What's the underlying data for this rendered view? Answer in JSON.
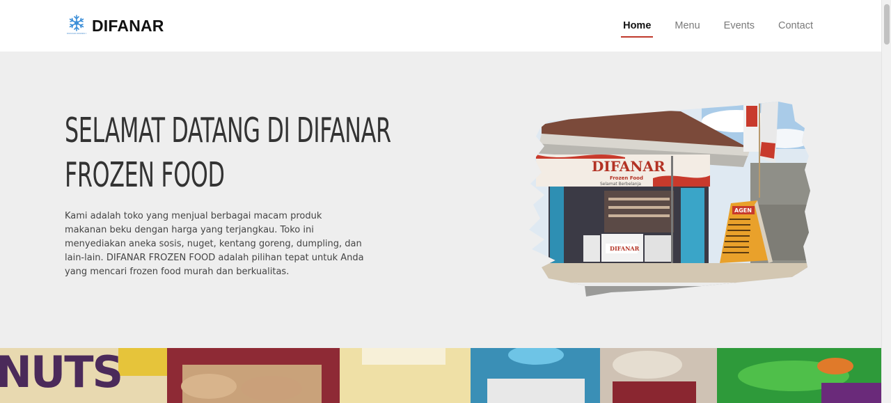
{
  "header": {
    "brand_name": "DIFANAR",
    "logo_caption": "DIFANAR FROZEN FOOD",
    "nav": [
      {
        "label": "Home",
        "active": true
      },
      {
        "label": "Menu",
        "active": false
      },
      {
        "label": "Events",
        "active": false
      },
      {
        "label": "Contact",
        "active": false
      }
    ]
  },
  "hero": {
    "title_line1": "SELAMAT DATANG DI DIFANAR",
    "title_line2": "FROZEN FOOD",
    "description": "Kami adalah toko yang menjual berbagai macam produk makanan beku dengan harga yang terjangkau. Toko ini menyediakan aneka sosis, nuget, kentang goreng, dumpling, dan lain-lain. DIFANAR FROZEN FOOD adalah pilihan tepat untuk Anda yang mencari frozen food murah dan berkualitas.",
    "photo": {
      "store_sign": "DIFANAR",
      "store_sign_sub": "Frozen Food",
      "store_sign_tag": "Selamat Berbelanja",
      "banner_text": "AGEN",
      "fridge_label": "DIFANAR"
    }
  },
  "strip": {
    "package_text": "NUTS"
  },
  "colors": {
    "accent": "#c0392b",
    "hero_bg": "#eeeeee",
    "header_bg": "#ffffff"
  }
}
